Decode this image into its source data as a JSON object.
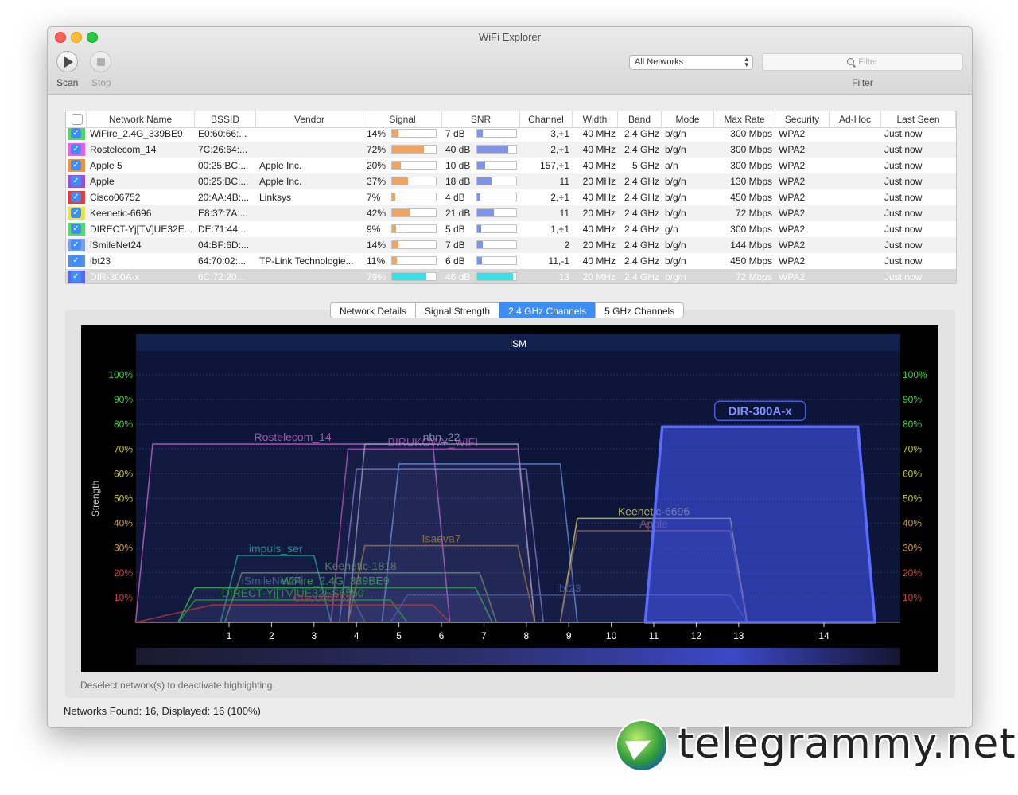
{
  "window": {
    "title": "WiFi Explorer"
  },
  "toolbar": {
    "scan_label": "Scan",
    "stop_label": "Stop",
    "network_filter_value": "All Networks",
    "filter_placeholder": "Filter",
    "filter_caption": "Filter"
  },
  "table": {
    "columns": [
      "Network Name",
      "BSSID",
      "Vendor",
      "Signal",
      "SNR",
      "Channel",
      "Width",
      "Band",
      "Mode",
      "Max Rate",
      "Security",
      "Ad-Hoc",
      "Last Seen"
    ],
    "rows": [
      {
        "color": "#4cd964",
        "name": "WiFire_2.4G_339BE9",
        "bssid": "E0:60:66:...",
        "vendor": "",
        "signal": "14%",
        "signal_level": 14,
        "snr": "7 dB",
        "snr_level": 7,
        "channel": "3,+1",
        "width": "40 MHz",
        "band": "2.4 GHz",
        "mode": "b/g/n",
        "max_rate": "300 Mbps",
        "security": "WPA2",
        "adhoc": "",
        "last_seen": "Just now"
      },
      {
        "color": "#e85ce8",
        "name": "Rostelecom_14",
        "bssid": "7C:26:64:...",
        "vendor": "",
        "signal": "72%",
        "signal_level": 72,
        "snr": "40 dB",
        "snr_level": 40,
        "channel": "2,+1",
        "width": "40 MHz",
        "band": "2.4 GHz",
        "mode": "b/g/n",
        "max_rate": "300 Mbps",
        "security": "WPA2",
        "adhoc": "",
        "last_seen": "Just now"
      },
      {
        "color": "#f0923a",
        "name": "Apple 5",
        "bssid": "00:25:BC:...",
        "vendor": "Apple Inc.",
        "signal": "20%",
        "signal_level": 20,
        "snr": "10 dB",
        "snr_level": 10,
        "channel": "157,+1",
        "width": "40 MHz",
        "band": "5 GHz",
        "mode": "a/n",
        "max_rate": "300 Mbps",
        "security": "WPA2",
        "adhoc": "",
        "last_seen": "Just now"
      },
      {
        "color": "#9a4fd6",
        "name": "Apple",
        "bssid": "00:25:BC:...",
        "vendor": "Apple Inc.",
        "signal": "37%",
        "signal_level": 37,
        "snr": "18 dB",
        "snr_level": 18,
        "channel": "11",
        "width": "20 MHz",
        "band": "2.4 GHz",
        "mode": "b/g/n",
        "max_rate": "130 Mbps",
        "security": "WPA2",
        "adhoc": "",
        "last_seen": "Just now"
      },
      {
        "color": "#e8383a",
        "name": "Cisco06752",
        "bssid": "20:AA:4B:...",
        "vendor": "Linksys",
        "signal": "7%",
        "signal_level": 7,
        "snr": "4 dB",
        "snr_level": 4,
        "channel": "2,+1",
        "width": "40 MHz",
        "band": "2.4 GHz",
        "mode": "b/g/n",
        "max_rate": "450 Mbps",
        "security": "WPA2",
        "adhoc": "",
        "last_seen": "Just now"
      },
      {
        "color": "#e6e24a",
        "name": "Keenetic-6696",
        "bssid": "E8:37:7A:...",
        "vendor": "",
        "signal": "42%",
        "signal_level": 42,
        "snr": "21 dB",
        "snr_level": 21,
        "channel": "11",
        "width": "20 MHz",
        "band": "2.4 GHz",
        "mode": "b/g/n",
        "max_rate": "72 Mbps",
        "security": "WPA2",
        "adhoc": "",
        "last_seen": "Just now"
      },
      {
        "color": "#5ad86a",
        "name": "DIRECT-Yj[TV]UE32E...",
        "bssid": "DE:71:44:...",
        "vendor": "",
        "signal": "9%",
        "signal_level": 9,
        "snr": "5 dB",
        "snr_level": 5,
        "channel": "1,+1",
        "width": "40 MHz",
        "band": "2.4 GHz",
        "mode": "g/n",
        "max_rate": "300 Mbps",
        "security": "WPA2",
        "adhoc": "",
        "last_seen": "Just now"
      },
      {
        "color": "#7d9ee8",
        "name": "iSmileNet24",
        "bssid": "04:BF:6D:...",
        "vendor": "",
        "signal": "14%",
        "signal_level": 14,
        "snr": "7 dB",
        "snr_level": 7,
        "channel": "2",
        "width": "20 MHz",
        "band": "2.4 GHz",
        "mode": "b/g/n",
        "max_rate": "144 Mbps",
        "security": "WPA2",
        "adhoc": "",
        "last_seen": "Just now"
      },
      {
        "color": "#5a8fd8",
        "name": "ibt23",
        "bssid": "64:70:02:...",
        "vendor": "TP-Link Technologie...",
        "signal": "11%",
        "signal_level": 11,
        "snr": "6 dB",
        "snr_level": 6,
        "channel": "11,-1",
        "width": "40 MHz",
        "band": "2.4 GHz",
        "mode": "b/g/n",
        "max_rate": "450 Mbps",
        "security": "WPA2",
        "adhoc": "",
        "last_seen": "Just now"
      },
      {
        "color": "#5468e8",
        "name": "DIR-300A-x",
        "bssid": "6C:72:20...",
        "vendor": "",
        "signal": "79%",
        "signal_level": 79,
        "snr": "46 dB",
        "snr_level": 46,
        "channel": "13",
        "width": "20 MHz",
        "band": "2.4 GHz",
        "mode": "b/g/n",
        "max_rate": "72 Mbps",
        "security": "WPA2",
        "adhoc": "",
        "last_seen": "Just now",
        "selected": true
      }
    ]
  },
  "tabs": [
    "Network Details",
    "Signal Strength",
    "2.4 GHz Channels",
    "5 GHz Channels"
  ],
  "active_tab_index": 2,
  "chart_data": {
    "type": "area",
    "title": "ISM",
    "ylabel": "Strength",
    "ylim": [
      0,
      100
    ],
    "yticks": [
      "10%",
      "20%",
      "30%",
      "40%",
      "50%",
      "60%",
      "70%",
      "80%",
      "90%",
      "100%"
    ],
    "xticks": [
      "1",
      "2",
      "3",
      "4",
      "5",
      "6",
      "7",
      "8",
      "9",
      "10",
      "11",
      "12",
      "13",
      "14"
    ],
    "series": [
      {
        "name": "Rostelecom_14",
        "color": "#c060c8",
        "x": [
          -1.2,
          -0.8,
          5.8,
          6.2
        ],
        "y": 72
      },
      {
        "name": "BIRUKOWY_WIFI",
        "color": "#b050b8",
        "x": [
          3.4,
          3.8,
          7.8,
          8.2
        ],
        "y": 70
      },
      {
        "name": "nbn_22",
        "color": "#9a9ac0",
        "x": [
          3.8,
          4.2,
          7.8,
          8.2
        ],
        "y": 72
      },
      {
        "name": "",
        "color": "#7a78c8",
        "x": [
          3.6,
          4.0,
          8.0,
          8.4
        ],
        "y": 62
      },
      {
        "name": "",
        "color": "#6a8ad8",
        "x": [
          4.6,
          5.0,
          8.8,
          9.2
        ],
        "y": 64
      },
      {
        "name": "Isaeva7",
        "color": "#a0783a",
        "x": [
          3.8,
          4.2,
          7.8,
          8.2
        ],
        "y": 31
      },
      {
        "name": "Keenetic-6696",
        "color": "#c8c860",
        "x": [
          8.8,
          9.2,
          12.8,
          13.2
        ],
        "y": 42
      },
      {
        "name": "Apple",
        "color": "#8a6070",
        "x": [
          8.8,
          9.2,
          12.8,
          13.2
        ],
        "y": 37
      },
      {
        "name": "impuls_ser",
        "color": "#2a9a9a",
        "x": [
          0.8,
          1.2,
          3.0,
          3.4
        ],
        "y": 27
      },
      {
        "name": "Keenetic-1818",
        "color": "#6a8a6a",
        "x": [
          0.9,
          1.3,
          6.9,
          7.3
        ],
        "y": 20
      },
      {
        "name": "iSmileNet24",
        "color": "#4a6a8a",
        "x": [
          -0.2,
          0.2,
          3.8,
          4.2
        ],
        "y": 14
      },
      {
        "name": "WiFire_2.4G_339BE9",
        "color": "#3aa84a",
        "x": [
          -0.2,
          0.2,
          6.8,
          7.2
        ],
        "y": 14
      },
      {
        "name": "DIRECT-Yj[TV]UE32ES6550",
        "color": "#2aa03a",
        "x": [
          -0.2,
          0.2,
          4.8,
          5.2
        ],
        "y": 9
      },
      {
        "name": "Cisco06752",
        "color": "#b83838",
        "x": [
          -1.2,
          0.6,
          5.8,
          6.2
        ],
        "y": 7
      },
      {
        "name": "ibt23",
        "color": "#4a5aa8",
        "x": [
          4.8,
          5.2,
          12.8,
          13.2
        ],
        "y": 11
      },
      {
        "name": "DIR-300A-x",
        "color": "#5a6cff",
        "x": [
          10.8,
          11.2,
          14.8,
          15.2
        ],
        "y": 79,
        "selected": true
      }
    ]
  },
  "hint": "Deselect network(s) to deactivate highlighting.",
  "status": "Networks Found: 16, Displayed: 16 (100%)",
  "watermark": {
    "text": "telegrammy.net"
  }
}
